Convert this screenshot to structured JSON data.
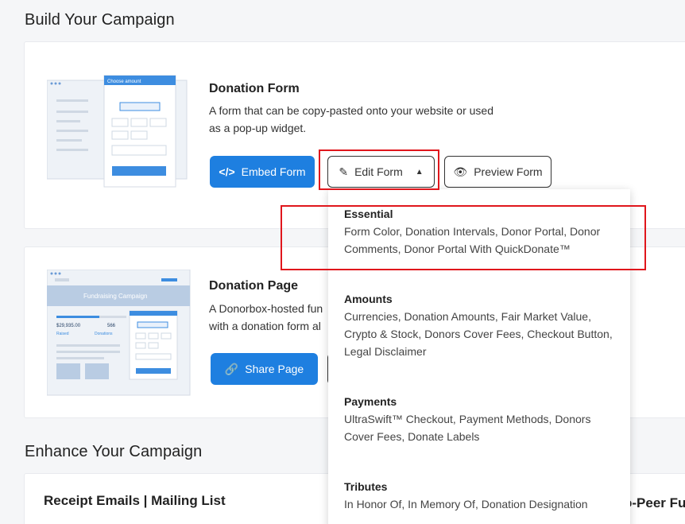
{
  "sections": {
    "build_title": "Build Your Campaign",
    "enhance_title": "Enhance Your Campaign"
  },
  "donation_form": {
    "title": "Donation Form",
    "description": "A form that can be copy-pasted onto your website or used as a pop-up widget.",
    "illustration_label": "Choose amount",
    "embed_label": "Embed Form",
    "edit_label": "Edit Form",
    "preview_label": "Preview Form"
  },
  "donation_page": {
    "title": "Donation Page",
    "description_line1": "A Donorbox-hosted fun",
    "description_line2": "with a donation form al",
    "share_label": "Share Page",
    "illustration_banner": "Fundraising Campaign",
    "illustration_amount": "$29,935.00",
    "illustration_raised": "Raised",
    "illustration_count": "566",
    "illustration_donations": "Donations"
  },
  "dropdown": {
    "groups": [
      {
        "title": "Essential",
        "items": "Form Color, Donation Intervals, Donor Portal, Donor Comments, Donor Portal With QuickDonate™"
      },
      {
        "title": "Amounts",
        "items": "Currencies, Donation Amounts, Fair Market Value, Crypto & Stock, Donors Cover Fees, Checkout Button, Legal Disclaimer"
      },
      {
        "title": "Payments",
        "items": "UltraSwift™ Checkout, Payment Methods, Donors Cover Fees, Donate Labels"
      },
      {
        "title": "Tributes",
        "items": "In Honor Of, In Memory Of, Donation Designation"
      }
    ]
  },
  "enhance": {
    "receipt_title": "Receipt Emails | Mailing List",
    "p2p_partial": "o-Peer Fu"
  },
  "colors": {
    "primary": "#1e7fe0",
    "highlight": "#e0161c"
  }
}
